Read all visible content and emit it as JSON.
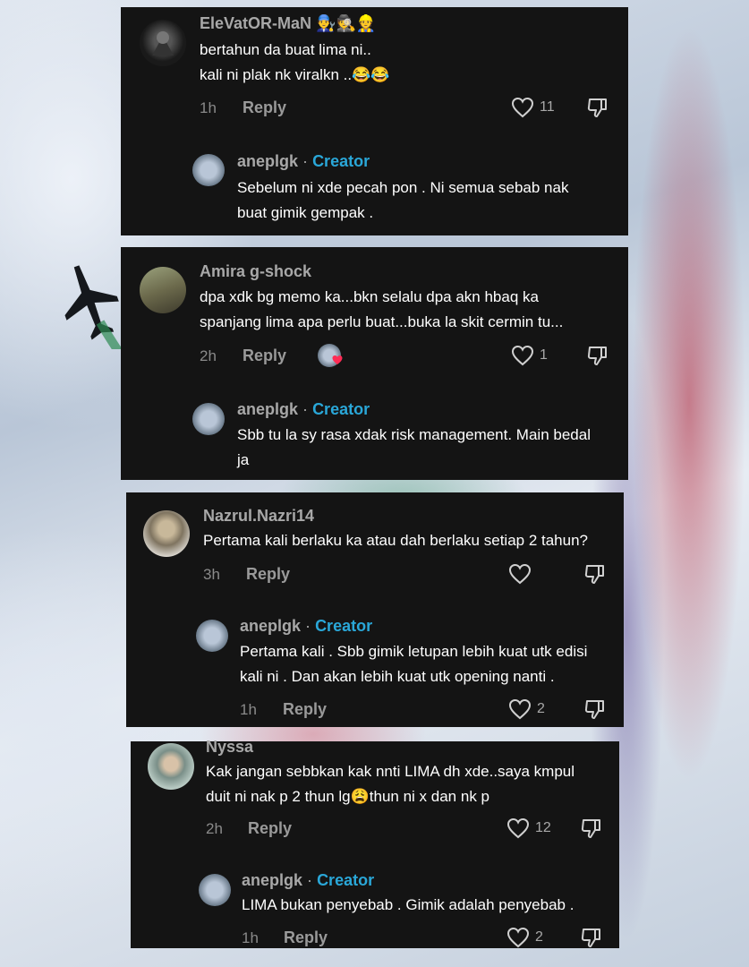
{
  "comments": [
    {
      "username": "EleVatOR-MaN",
      "username_emoji": "👨‍🔧🕵️👷",
      "text_lines": [
        "bertahun da buat lima ni..",
        "kali ni plak nk viralkn ..😂😂"
      ],
      "time": "1h",
      "reply_label": "Reply",
      "likes": "11",
      "reply": {
        "username": "aneplgk",
        "separator": "·",
        "creator_label": "Creator",
        "text_lines": [
          "Sebelum ni xde pecah pon . Ni semua sebab nak",
          "buat gimik gempak ."
        ]
      }
    },
    {
      "username": "Amira g-shock",
      "text_lines": [
        "dpa xdk bg memo ka...bkn selalu dpa akn hbaq ka",
        "spanjang lima apa perlu buat...buka la skit cermin tu..."
      ],
      "time": "2h",
      "reply_label": "Reply",
      "likes": "1",
      "reply": {
        "username": "aneplgk",
        "separator": "·",
        "creator_label": "Creator",
        "text_lines": [
          "Sbb tu la sy rasa xdak risk management. Main bedal",
          "ja"
        ]
      }
    },
    {
      "username": "Nazrul.Nazri14",
      "text_lines": [
        "Pertama kali berlaku ka atau dah berlaku setiap 2 tahun?"
      ],
      "time": "3h",
      "reply_label": "Reply",
      "likes": "",
      "reply": {
        "username": "aneplgk",
        "separator": "·",
        "creator_label": "Creator",
        "text_lines": [
          "Pertama kali . Sbb gimik letupan lebih kuat utk edisi",
          "kali ni . Dan akan lebih kuat utk opening nanti ."
        ],
        "time": "1h",
        "reply_label": "Reply",
        "likes": "2"
      }
    },
    {
      "username": "Nyssa",
      "text_lines": [
        "Kak jangan sebbkan kak nnti LIMA dh xde..saya kmpul",
        "duit ni nak p 2 thun lg😩thun ni x dan nk p"
      ],
      "time": "2h",
      "reply_label": "Reply",
      "likes": "12",
      "reply": {
        "username": "aneplgk",
        "separator": "·",
        "creator_label": "Creator",
        "text_lines": [
          "LIMA bukan penyebab . Gimik adalah penyebab ."
        ],
        "time": "1h",
        "reply_label": "Reply",
        "likes": "2"
      }
    }
  ],
  "colors": {
    "card_bg": "#141414",
    "creator": "#2aa7d8",
    "muted": "#8a8a8a"
  },
  "icons": [
    "heart-outline-icon",
    "thumbs-down-icon",
    "airplane-icon"
  ]
}
